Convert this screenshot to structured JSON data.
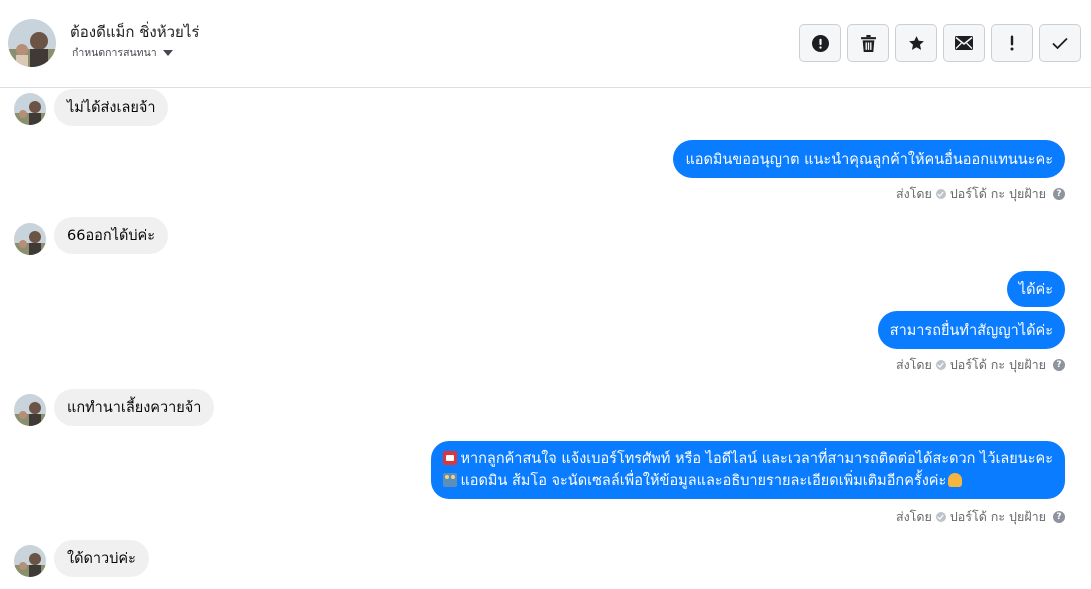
{
  "header": {
    "contact_name": "ต้องดีแม็ก ชิ่งห้วยไร่",
    "conversation_settings_label": "กำหนดการสนทนา",
    "toolbar": [
      {
        "name": "report-spam-button",
        "icon": "alert-circle-icon"
      },
      {
        "name": "delete-button",
        "icon": "trash-icon"
      },
      {
        "name": "star-button",
        "icon": "star-icon"
      },
      {
        "name": "mark-unread-button",
        "icon": "envelope-icon"
      },
      {
        "name": "important-button",
        "icon": "exclamation-icon"
      },
      {
        "name": "done-button",
        "icon": "check-icon"
      }
    ]
  },
  "messages": {
    "m1": {
      "text": "ไม่ได้ส่งเลยจ้า"
    },
    "m2": {
      "text": "แอดมินขออนุญาต แนะนำคุณลูกค้าให้คนอื่นออกแทนนะคะ",
      "sent_by_label": "ส่งโดย",
      "sender": "ปอร์โด้ กะ ปุยฝ้าย"
    },
    "m3": {
      "text": "66ออกได้บ่ค่ะ"
    },
    "m4": {
      "text": "ได้ค่ะ"
    },
    "m5": {
      "text": "สามารถยื่นทำสัญญาได้ค่ะ",
      "sent_by_label": "ส่งโดย",
      "sender": "ปอร์โด้ กะ ปุยฝ้าย"
    },
    "m6": {
      "text": "แกทำนาเลี้ยงควายจ้า"
    },
    "m7": {
      "line1": "หากลูกค้าสนใจ แจ้งเบอร์โทรศัพท์ หรือ ไอดีไลน์ และเวลาที่สามารถติดต่อได้สะดวก ไว้เลยนะคะ",
      "line2": "แอดมิน ส้มโอ จะนัดเซลล์เพื่อให้ข้อมูลและอธิบายรายละเอียดเพิ่มเติมอีกครั้งค่ะ",
      "sent_by_label": "ส่งโดย",
      "sender": "ปอร์โด้ กะ ปุยฝ้าย"
    },
    "m8": {
      "text": "ใด้ดาวบ่ค่ะ"
    }
  },
  "colors": {
    "outgoing_bubble": "#0a7cff",
    "incoming_bubble": "#f0f0f0",
    "muted_text": "#65676b"
  }
}
